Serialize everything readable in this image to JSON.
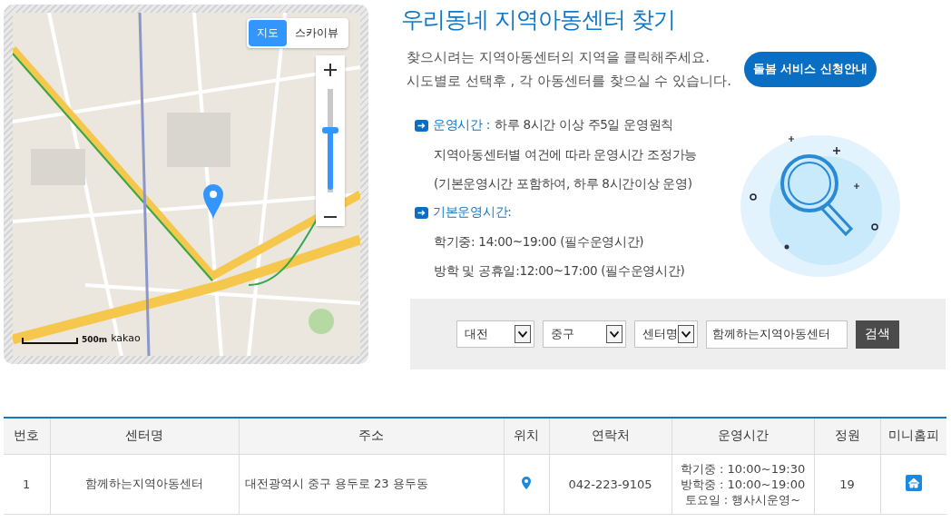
{
  "map": {
    "map_types": [
      {
        "label": "지도",
        "selected": true
      },
      {
        "label": "스카이뷰",
        "selected": false
      }
    ],
    "zoom": {
      "level": 0.6
    },
    "scale": "500m",
    "provider": "kakao"
  },
  "title": "우리동네 지역아동센터 찾기",
  "intro": [
    "찾으시려는 지역아동센터의 지역을 클릭해주세요.",
    "시도별로 선택후 , 각 아동센터를 찾으실 수 있습니다."
  ],
  "guide_button": "돌봄 서비스 신청안내",
  "info": [
    {
      "heading": "운영시간 :",
      "text": "하루 8시간 이상 주5일 운영원칙",
      "lines": [
        "지역아동센터별 여건에 따라 운영시간 조정가능",
        "(기본운영시간 포함하여, 하루 8시간이상 운영)"
      ]
    },
    {
      "heading": "기본운영시간:",
      "lines": [
        "학기중: 14:00~19:00 (필수운영시간)",
        "방학 및 공휴일:12:00~17:00 (필수운영시간)"
      ]
    }
  ],
  "search": {
    "selects": [
      "대전",
      "중구",
      "센터명"
    ],
    "query": "함께하는지역아동센터",
    "button": "검색"
  },
  "table": {
    "columns": [
      "번호",
      "센터명",
      "주소",
      "위치",
      "연락처",
      "운영시간",
      "정원",
      "미니홈피"
    ],
    "rows": [
      {
        "number": "1",
        "name": "함께하는지역아동센터",
        "address": "대전광역시 중구 용두로 23 용두동",
        "phone": "042-223-9105",
        "hours": [
          "학기중 : 10:00~19:30",
          "방학중 : 10:00~19:00",
          "토요일 : 행사시운영~"
        ],
        "capacity": "19"
      }
    ]
  }
}
